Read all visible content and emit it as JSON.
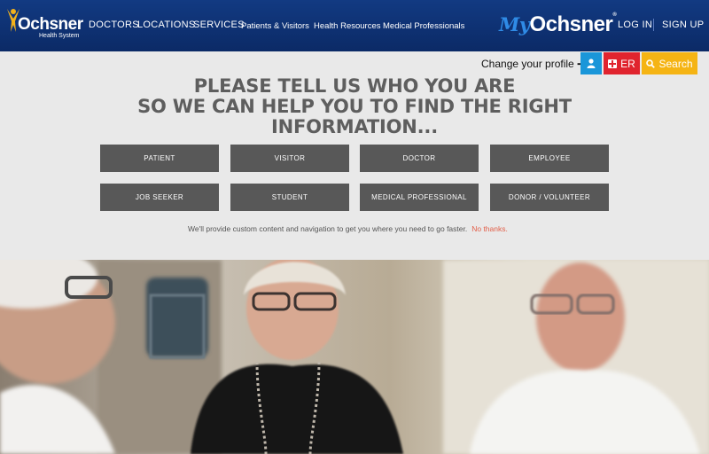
{
  "header": {
    "logo_name": "Ochsner",
    "logo_sub": "Health System",
    "nav": [
      "DOCTORS",
      "LOCATIONS",
      "SERVICES",
      "Patients & Visitors",
      "Health Resources",
      "Medical Professionals"
    ],
    "portal_prefix": "My",
    "portal_name": "Ochsner",
    "portal_tm": "®",
    "login": "LOG IN",
    "signup": "SIGN UP",
    "colors": {
      "bar": "#123a82",
      "accent": "#2f8be6"
    }
  },
  "utility": {
    "profile_link": "Change your profile",
    "profile_arrow_icon": "arrow-right-icon",
    "user_icon": "user-icon",
    "er_label": "ER",
    "search_label": "Search",
    "colors": {
      "user": "#1a96d9",
      "er": "#e0242e",
      "search": "#f5b414"
    }
  },
  "prompt": {
    "headline_1": "PLEASE TELL US WHO YOU ARE",
    "headline_2": "SO WE CAN HELP YOU TO FIND THE RIGHT",
    "headline_3": "INFORMATION...",
    "roles": [
      "PATIENT",
      "VISITOR",
      "DOCTOR",
      "EMPLOYEE",
      "JOB SEEKER",
      "STUDENT",
      "MEDICAL PROFESSIONAL",
      "DONOR / VOLUNTEER"
    ],
    "note": "We'll provide custom content and navigation to get you where you need to go faster.",
    "no_thanks": "No thanks."
  }
}
